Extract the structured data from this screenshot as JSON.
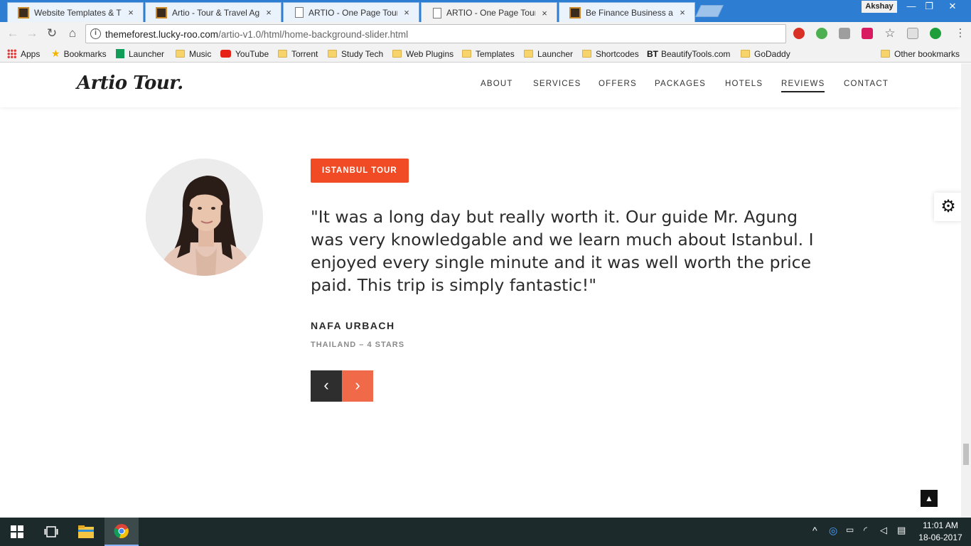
{
  "browser": {
    "tabs": [
      {
        "title": "Website Templates & Th",
        "favicon": "envato-icon",
        "active": false
      },
      {
        "title": "Artio - Tour & Travel Age",
        "favicon": "envato-icon",
        "active": false
      },
      {
        "title": "ARTIO - One Page Tour &",
        "favicon": "page-icon",
        "active": false
      },
      {
        "title": "ARTIO - One Page Tour &",
        "favicon": "page-icon",
        "active": true
      },
      {
        "title": "Be Finance Business and",
        "favicon": "envato-icon",
        "active": false
      }
    ],
    "tab_close": "×",
    "profile_name": "Akshay",
    "window_controls": {
      "minimize": "—",
      "restore": "❐",
      "close": "✕"
    },
    "url_host": "themeforest.lucky-roo.com",
    "url_path": "/artio-v1.0/html/home-background-slider.html",
    "nav_glyphs": {
      "back": "←",
      "forward": "→",
      "reload": "↻",
      "home": "⌂",
      "info": "i",
      "star": "☆"
    },
    "bookmarks": [
      {
        "label": "Apps",
        "icon": "apps-grid-icon"
      },
      {
        "label": "Bookmarks",
        "icon": "star-icon"
      },
      {
        "label": "Launcher",
        "icon": "sheet-icon"
      },
      {
        "label": "Music",
        "icon": "folder-icon"
      },
      {
        "label": "YouTube",
        "icon": "youtube-icon"
      },
      {
        "label": "Torrent",
        "icon": "folder-icon"
      },
      {
        "label": "Study Tech",
        "icon": "folder-icon"
      },
      {
        "label": "Web Plugins",
        "icon": "folder-icon"
      },
      {
        "label": "Templates",
        "icon": "folder-icon"
      },
      {
        "label": "Launcher",
        "icon": "folder-icon"
      },
      {
        "label": "Shortcodes",
        "icon": "folder-icon"
      },
      {
        "label": "BeautifyTools.com",
        "icon": "bt-icon"
      },
      {
        "label": "GoDaddy",
        "icon": "folder-icon"
      }
    ],
    "other_bookmarks": "Other bookmarks"
  },
  "site": {
    "logo": "Artio Tour.",
    "menu": [
      {
        "label": "ABOUT",
        "active": false
      },
      {
        "label": "SERVICES",
        "active": false
      },
      {
        "label": "OFFERS",
        "active": false
      },
      {
        "label": "PACKAGES",
        "active": false
      },
      {
        "label": "HOTELS",
        "active": false
      },
      {
        "label": "REVIEWS",
        "active": true
      },
      {
        "label": "CONTACT",
        "active": false
      }
    ],
    "review": {
      "tag": "ISTANBUL TOUR",
      "quote": "\"It was a long day but really worth it. Our guide Mr. Agung was very knowledgable and we learn much about Istanbul. I enjoyed every single minute and it was well worth the price paid. This trip is simply fantastic!\"",
      "author": "NAFA URBACH",
      "meta": "THAILAND – 4 STARS",
      "prev_glyph": "‹",
      "next_glyph": "›"
    },
    "settings_glyph": "⚙",
    "back_to_top_glyph": "▲"
  },
  "taskbar": {
    "time": "11:01 AM",
    "date": "18-06-2017"
  },
  "colors": {
    "accent": "#f04b24",
    "next_button": "#f06a4a",
    "prev_button": "#2e2e2e",
    "chrome_blue": "#2d7dd2",
    "taskbar": "#1d2a2c"
  }
}
